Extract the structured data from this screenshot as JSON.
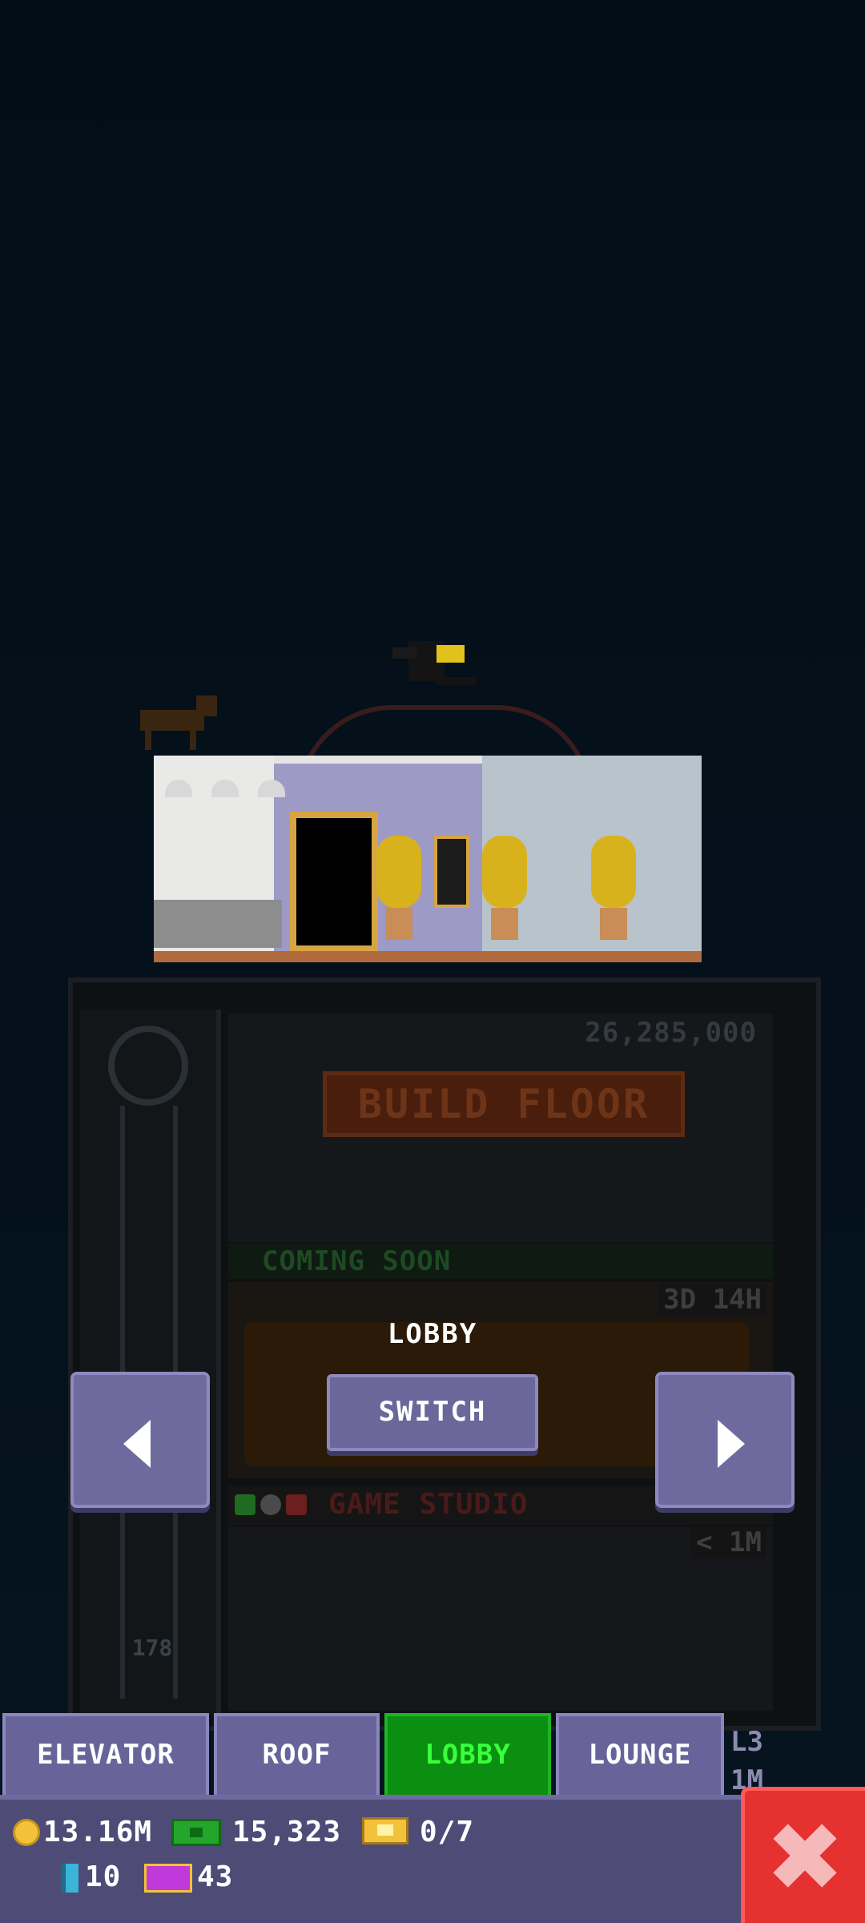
{
  "tower": {
    "build_floor": {
      "cost": "26,285,000",
      "label": "BUILD FLOOR"
    },
    "coming_soon": "COMING SOON",
    "lounge_timer": "3D 14H",
    "studio": {
      "name": "GAME STUDIO",
      "timer": "< 1M"
    },
    "elevator_floor_number": "178"
  },
  "overlay": {
    "floor_title": "LOBBY",
    "switch_label": "SWITCH"
  },
  "tabs": [
    {
      "label": "ELEVATOR",
      "active": false
    },
    {
      "label": "ROOF",
      "active": false
    },
    {
      "label": "LOBBY",
      "active": true
    },
    {
      "label": "LOUNGE",
      "active": false
    }
  ],
  "tabs_side": {
    "line1": "L3",
    "line2": "1M"
  },
  "status": {
    "coins": "13.16M",
    "bux": "15,323",
    "tickets": "0/7",
    "keys": "10",
    "vip": "43"
  },
  "colors": {
    "active_tab": "#0a8f10",
    "tab": "#68649a",
    "close": "#e63131",
    "background": "#030d17"
  },
  "icons": [
    "coin-icon",
    "bux-icon",
    "ticket-icon",
    "key-icon",
    "vip-icon",
    "close-icon",
    "arrow-left-icon",
    "arrow-right-icon"
  ]
}
